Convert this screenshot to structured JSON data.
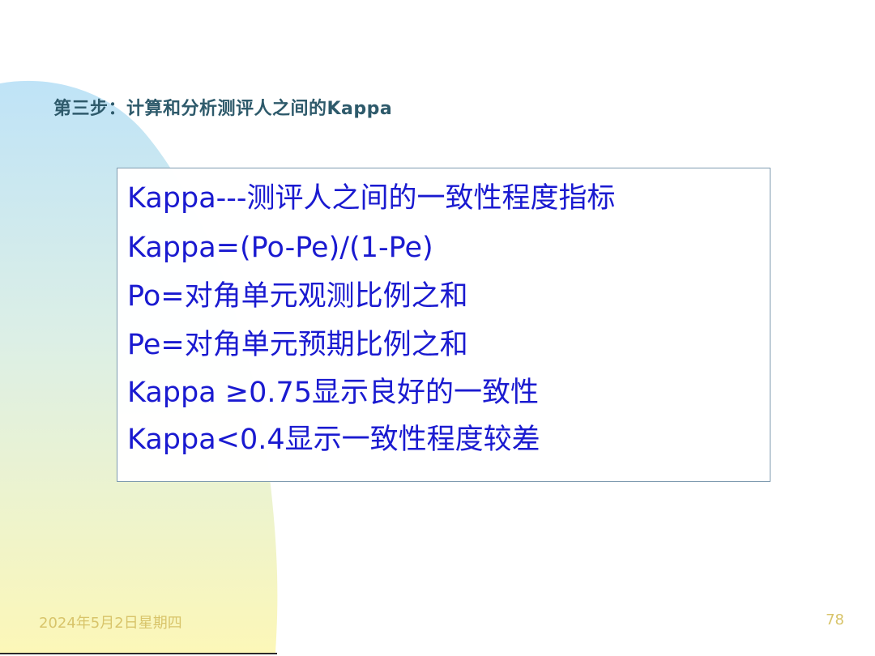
{
  "slide": {
    "title": "第三步：计算和分析测评人之间的Kappa",
    "lines": [
      "Kappa---测评人之间的一致性程度指标",
      "Kappa=(Po-Pe)/(1-Pe)",
      "Po=对角单元观测比例之和",
      "Pe=对角单元预期比例之和",
      "Kappa ≥0.75显示良好的一致性",
      "Kappa<0.4显示一致性程度较差"
    ],
    "date": "2024年5月2日星期四",
    "page_number": "78"
  },
  "colors": {
    "title": "#2e5a6b",
    "body_text": "#1a1ad0",
    "footer": "#d8c46a",
    "gradient_top": "#bfe3f7",
    "gradient_bottom": "#fcf7b8"
  }
}
